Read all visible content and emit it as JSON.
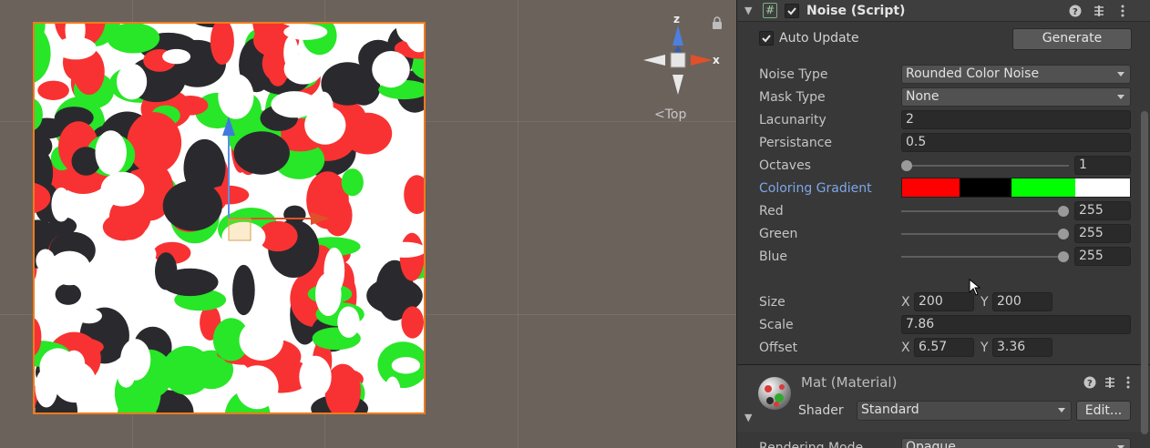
{
  "scene": {
    "gizmo_axis_z": "z",
    "gizmo_axis_x": "x",
    "view_label": "Top",
    "view_label_icon": "perspective-icon",
    "selection_color": "#f07b1c",
    "noise_colors": [
      "#f83232",
      "#2a2a2e",
      "#28e628",
      "#ffffff"
    ]
  },
  "component": {
    "title": "Noise (Script)",
    "enabled": true,
    "auto_update_label": "Auto Update",
    "auto_update_checked": true,
    "generate_label": "Generate",
    "fields": {
      "noise_type": {
        "label": "Noise Type",
        "value": "Rounded Color Noise"
      },
      "mask_type": {
        "label": "Mask Type",
        "value": "None"
      },
      "lacunarity": {
        "label": "Lacunarity",
        "value": "2"
      },
      "persistance": {
        "label": "Persistance",
        "value": "0.5"
      },
      "octaves": {
        "label": "Octaves",
        "value": "1",
        "slider_fraction": 0.0
      },
      "coloring_gradient": {
        "label": "Coloring Gradient",
        "stops": [
          "#ff0000",
          "#000000",
          "#00ff00",
          "#ffffff"
        ]
      },
      "red": {
        "label": "Red",
        "value": "255",
        "slider_fraction": 1.0
      },
      "green": {
        "label": "Green",
        "value": "255",
        "slider_fraction": 1.0
      },
      "blue": {
        "label": "Blue",
        "value": "255",
        "slider_fraction": 1.0
      },
      "size": {
        "label": "Size",
        "x_label": "X",
        "x": "200",
        "y_label": "Y",
        "y": "200"
      },
      "scale": {
        "label": "Scale",
        "value": "7.86"
      },
      "offset": {
        "label": "Offset",
        "x_label": "X",
        "x": "6.57",
        "y_label": "Y",
        "y": "3.36"
      }
    }
  },
  "material": {
    "title": "Mat (Material)",
    "shader_label": "Shader",
    "shader_value": "Standard",
    "edit_label": "Edit...",
    "rendering_mode_label": "Rendering Mode",
    "rendering_mode_value": "Opaque"
  }
}
